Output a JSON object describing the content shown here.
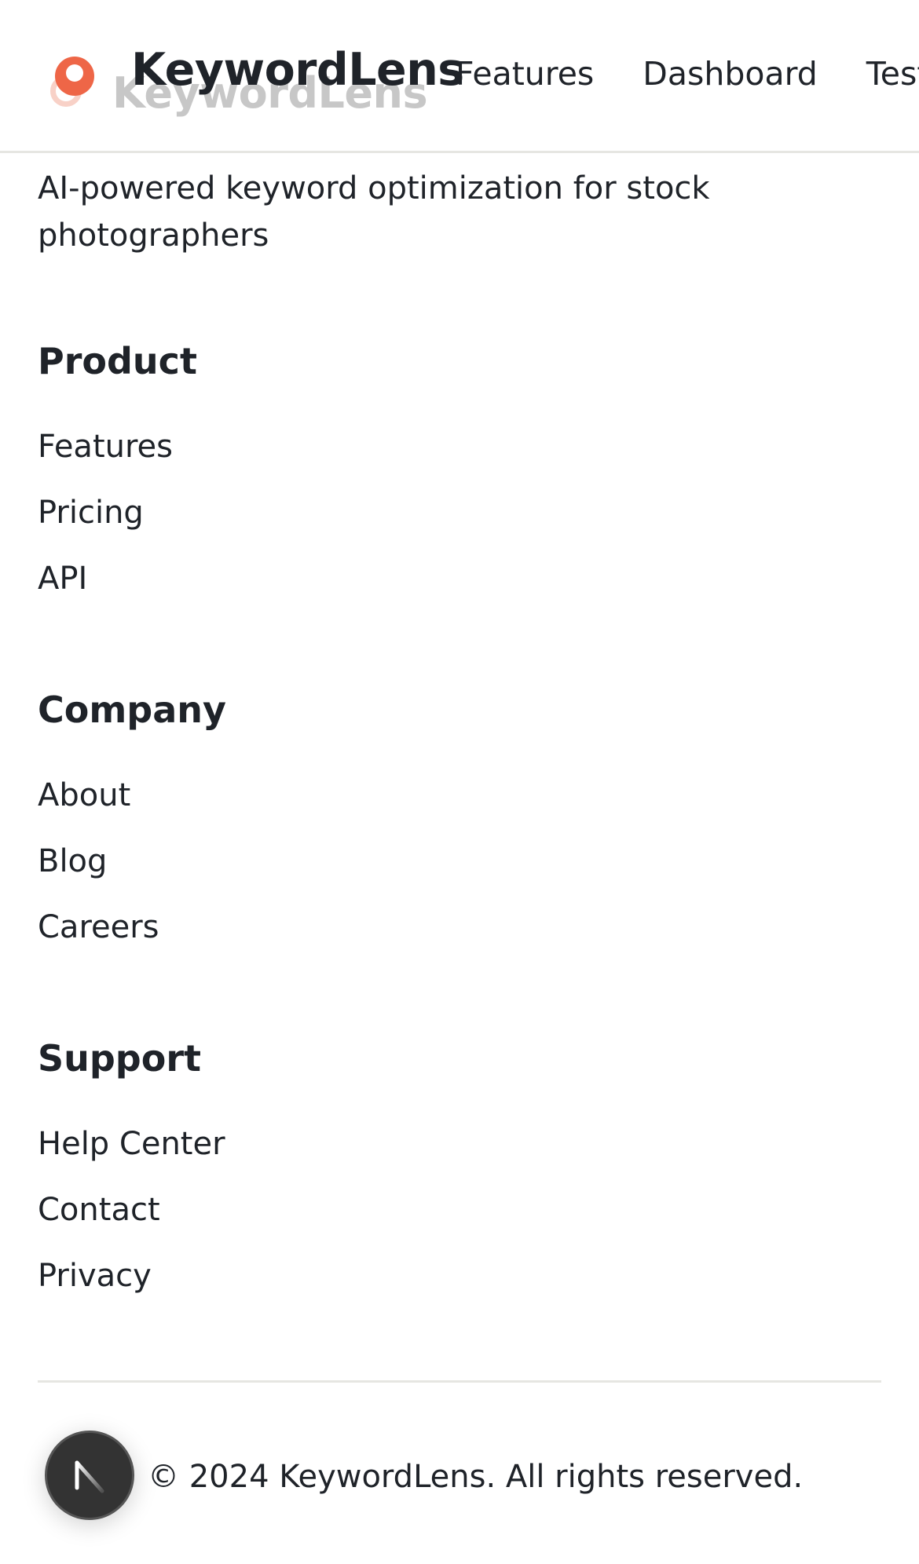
{
  "header": {
    "brand": "KeywordLens",
    "brand_ghost": "KeywordLens",
    "nav": [
      "Features",
      "Dashboard",
      "Test"
    ]
  },
  "footer": {
    "tagline": "AI-powered keyword optimization for stock photographers",
    "columns": [
      {
        "title": "Product",
        "links": [
          "Features",
          "Pricing",
          "API"
        ]
      },
      {
        "title": "Company",
        "links": [
          "About",
          "Blog",
          "Careers"
        ]
      },
      {
        "title": "Support",
        "links": [
          "Help Center",
          "Contact",
          "Privacy"
        ]
      }
    ],
    "copyright": "© 2024 KeywordLens. All rights reserved."
  },
  "colors": {
    "accent": "#ee6647",
    "text": "#1f2329",
    "divider": "#e6e6e2",
    "float_button": "#333333"
  },
  "icons": {
    "brand": "logo-icon",
    "floating": "n-logo-icon"
  }
}
